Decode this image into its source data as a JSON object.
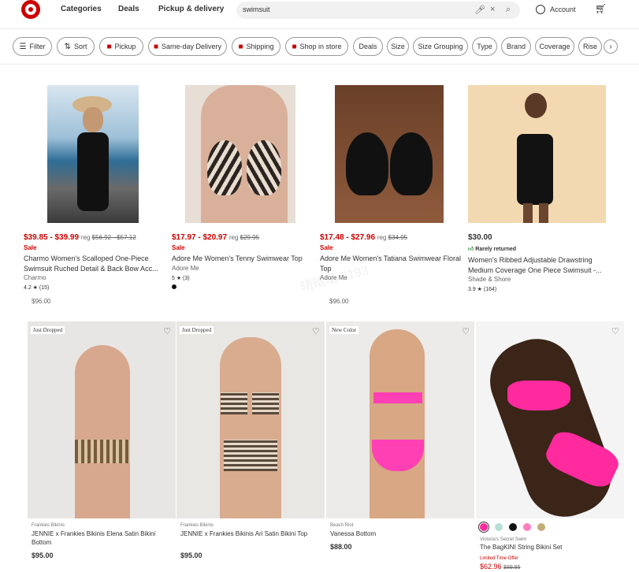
{
  "header": {
    "nav": [
      "Categories",
      "Deals",
      "Pickup & delivery"
    ],
    "search_value": "swimsuit",
    "account_label": "Account"
  },
  "filters": [
    "Filter",
    "Sort",
    "Pickup",
    "Same-day Delivery",
    "Shipping",
    "Shop in store",
    "Deals",
    "Size",
    "Size Grouping",
    "Type",
    "Brand",
    "Coverage",
    "Rise"
  ],
  "row1": [
    {
      "price": "$39.85 - $39.99",
      "reg": "reg",
      "reg_price": "$56.92 - $57.12",
      "sale": "Sale",
      "title": "Charmo Women's Scalloped One-Piece Swimsuit Ruched Detail & Back Bow Acc...",
      "brand": "Charmo",
      "rating": "4.2 ★ (15)",
      "sub_price": "$96.00",
      "price_color": "#cc0000"
    },
    {
      "price": "$17.97 - $20.97",
      "reg": "reg",
      "reg_price": "$29.95",
      "sale": "Sale",
      "title": "Adore Me Women's Tenny Swimwear Top",
      "brand": "Adore Me",
      "rating": "5 ★ (3)",
      "price_color": "#cc0000"
    },
    {
      "price": "$17.48 - $27.96",
      "reg": "reg",
      "reg_price": "$34.95",
      "sale": "Sale",
      "title": "Adore Me Women's Tatiana Swimwear Floral Top",
      "brand": "Adore Me",
      "sub_price": "$96.00",
      "price_color": "#cc0000"
    },
    {
      "price": "$30.00",
      "returned": "Rarely returned",
      "title": "Women's Ribbed Adjustable Drawstring Medium Coverage One Piece Swimsuit -...",
      "brand": "Shade & Shore",
      "rating": "3.9 ★ (164)",
      "price_color": "#333333"
    }
  ],
  "row2": [
    {
      "tag": "Just Dropped",
      "brand": "Frankies Bikinis",
      "title": "JENNIE x Frankies Bikinis Elena Satin Bikini Bottom",
      "price": "$95.00"
    },
    {
      "tag": "Just Dropped",
      "brand": "Frankies Bikinis",
      "title": "JENNIE x Frankies Bikinis Ari Satin Bikini Top",
      "price": "$95.00"
    },
    {
      "tag": "New Color",
      "brand": "Beach Riot",
      "title": "Vanessa Bottom",
      "price": "$88.00"
    },
    {
      "brand": "Victoria's Secret Swim",
      "title": "The BagKINI String Bikini Set",
      "limited": "Limited Time Offer",
      "price": "$62.96",
      "old_price": "$89.95"
    }
  ],
  "colors": {
    "target_red": "#cc0000",
    "sale_red": "#cc0000"
  },
  "watermark": "晴晴晴 6193"
}
